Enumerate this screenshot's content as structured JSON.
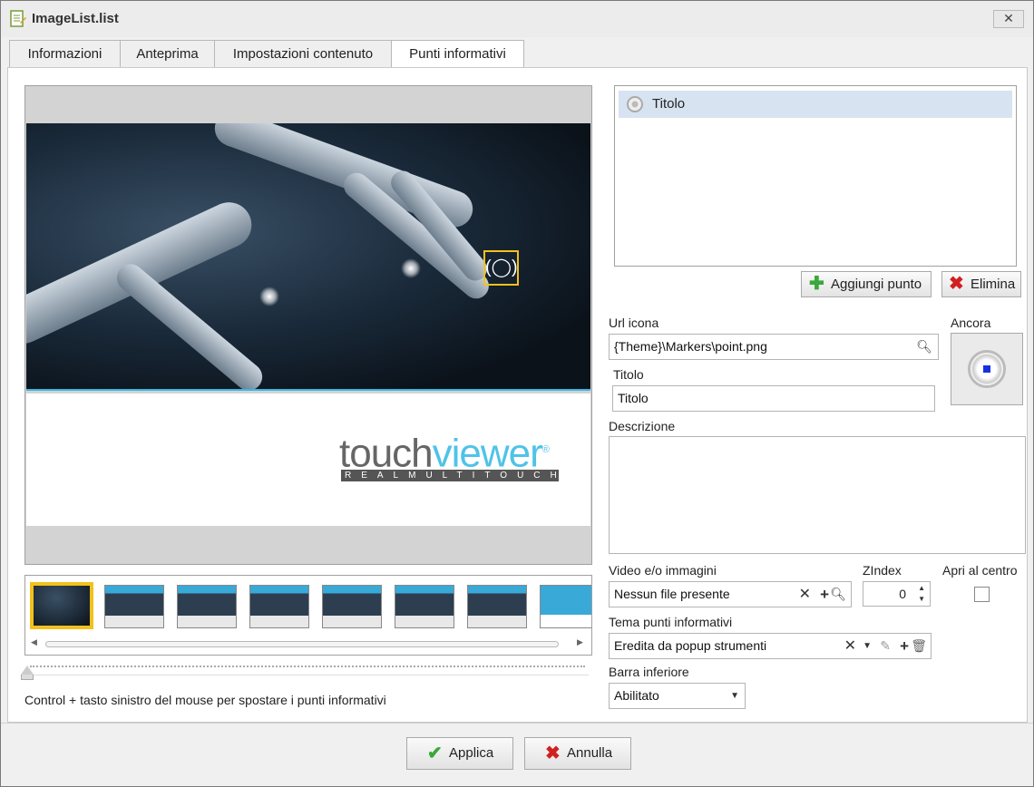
{
  "window": {
    "title": "ImageList.list",
    "close_label": "✕"
  },
  "tabs": [
    {
      "label": "Informazioni"
    },
    {
      "label": "Anteprima"
    },
    {
      "label": "Impostazioni contenuto"
    },
    {
      "label": "Punti informativi"
    }
  ],
  "preview": {
    "logo_touch": "touch",
    "logo_viewer": "viewer",
    "logo_reg": "®",
    "logo_sub": "REALMULTITOUCH",
    "marker_icon": "target-icon",
    "marker_glyph": "(◯)"
  },
  "hint": "Control + tasto sinistro del mouse per spostare i punti informativi",
  "points": [
    {
      "label": "Titolo"
    }
  ],
  "buttons": {
    "add_point": "Aggiungi punto",
    "delete": "Elimina",
    "apply": "Applica",
    "cancel": "Annulla"
  },
  "form": {
    "url_icon_label": "Url icona",
    "url_icon_value": "{Theme}\\Markers\\point.png",
    "anchor_label": "Ancora",
    "title_label": "Titolo",
    "title_value": "Titolo",
    "description_label": "Descrizione",
    "description_value": "",
    "video_label": "Video e/o immagini",
    "video_value": "Nessun file presente",
    "zindex_label": "ZIndex",
    "zindex_value": "0",
    "open_center_label": "Apri al centro",
    "theme_label": "Tema punti informativi",
    "theme_value": "Eredita da popup strumenti",
    "bottom_bar_label": "Barra inferiore",
    "bottom_bar_value": "Abilitato"
  },
  "colors": {
    "accent_yellow": "#f2c11c",
    "cyan": "#38b7e6",
    "selection": "#d7e3f0"
  }
}
